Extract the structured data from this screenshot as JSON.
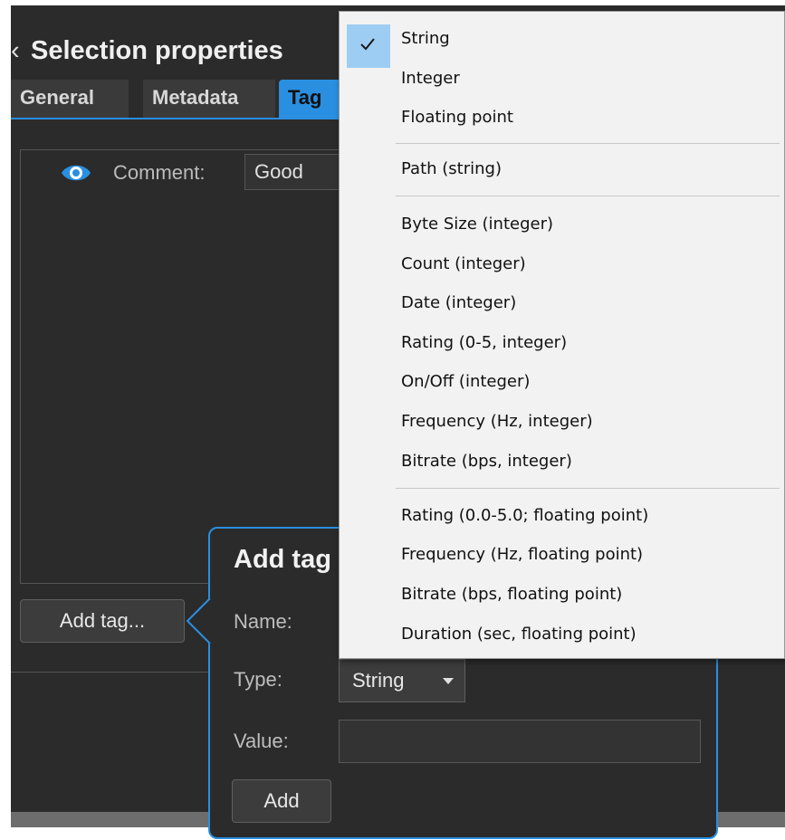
{
  "window": {
    "title": "Selection properties"
  },
  "tabs": [
    {
      "label": "General"
    },
    {
      "label": "Metadata"
    },
    {
      "label": "Tag"
    }
  ],
  "tags": {
    "comment_label": "Comment:",
    "comment_value": "Good",
    "add_tag_button": "Add tag..."
  },
  "popup": {
    "title": "Add tag",
    "name_label": "Name:",
    "type_label": "Type:",
    "type_value": "String",
    "value_label": "Value:",
    "add_button": "Add"
  },
  "type_menu": {
    "selected": "String",
    "items": [
      "String",
      "Integer",
      "Floating point",
      "Path (string)",
      "Byte Size (integer)",
      "Count (integer)",
      "Date (integer)",
      "Rating (0-5, integer)",
      "On/Off (integer)",
      "Frequency (Hz, integer)",
      "Bitrate (bps, integer)",
      "Rating (0.0-5.0; floating point)",
      "Frequency (Hz, floating point)",
      "Bitrate (bps, floating point)",
      "Duration (sec, floating point)"
    ]
  },
  "colors": {
    "accent": "#2a8fe0",
    "panel": "#2b2b2b",
    "menu": "#f2f2f2",
    "check_highlight": "#9ecdf3"
  },
  "icons": {
    "back": "back-arrow-icon",
    "visibility": "eye-icon",
    "dropdown": "chevron-down-icon",
    "selected": "checkmark-icon"
  }
}
